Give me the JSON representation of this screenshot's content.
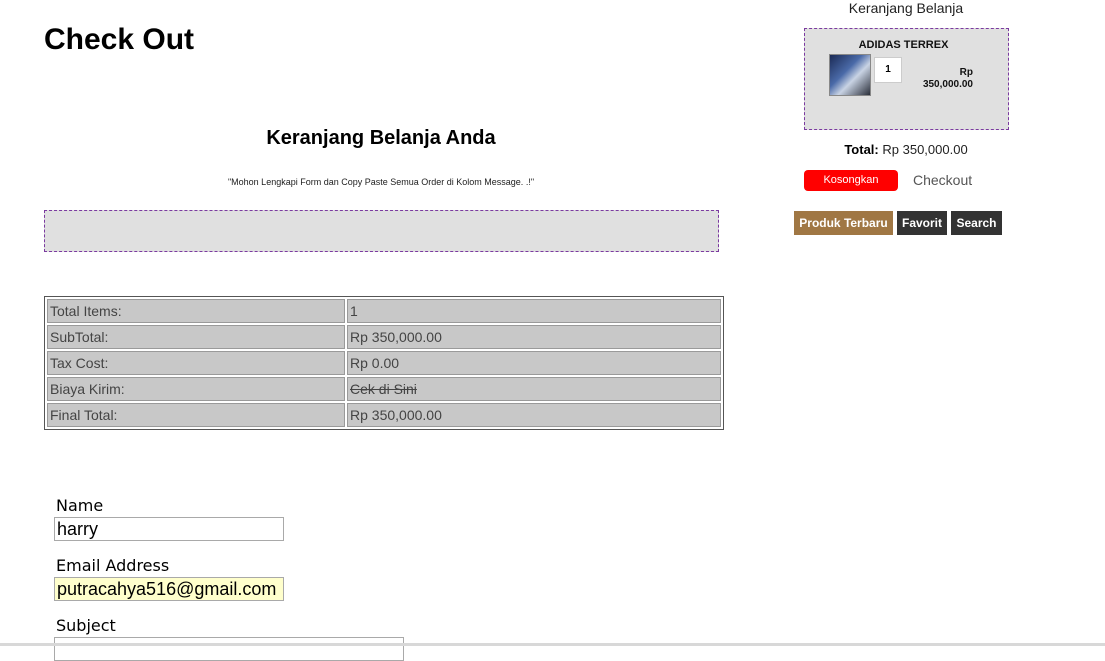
{
  "page": {
    "title": "Check Out"
  },
  "cart_section": {
    "heading": "Keranjang Belanja Anda",
    "note": "\"Mohon Lengkapi Form dan Copy Paste Semua Order di Kolom Message. .!\""
  },
  "summary": {
    "rows": [
      {
        "label": "Total Items:",
        "value": "1"
      },
      {
        "label": "SubTotal:",
        "value": "Rp 350,000.00"
      },
      {
        "label": "Tax Cost:",
        "value": "Rp 0.00"
      },
      {
        "label": "Biaya Kirim:",
        "value": "Cek di Sini"
      },
      {
        "label": "Final Total:",
        "value": "Rp 350,000.00"
      }
    ]
  },
  "form": {
    "name_label": "Name",
    "name_value": "harry",
    "email_label": "Email Address",
    "email_value": "putracahya516@gmail.com",
    "subject_label": "Subject",
    "subject_value": ""
  },
  "sidebar": {
    "title": "Keranjang Belanja",
    "product_name": "ADIDAS TERREX",
    "quantity": "1",
    "price_currency": "Rp",
    "price_amount": "350,000.00",
    "total_label": "Total:",
    "total_value": "Rp 350,000.00",
    "empty_button": "Kosongkan",
    "checkout_link": "Checkout",
    "nav": {
      "produk": "Produk Terbaru",
      "favorit": "Favorit",
      "search": "Search"
    },
    "colors": {
      "empty_button": "#ff0000",
      "produk_button": "#a07744",
      "nav_button": "#333333"
    }
  }
}
